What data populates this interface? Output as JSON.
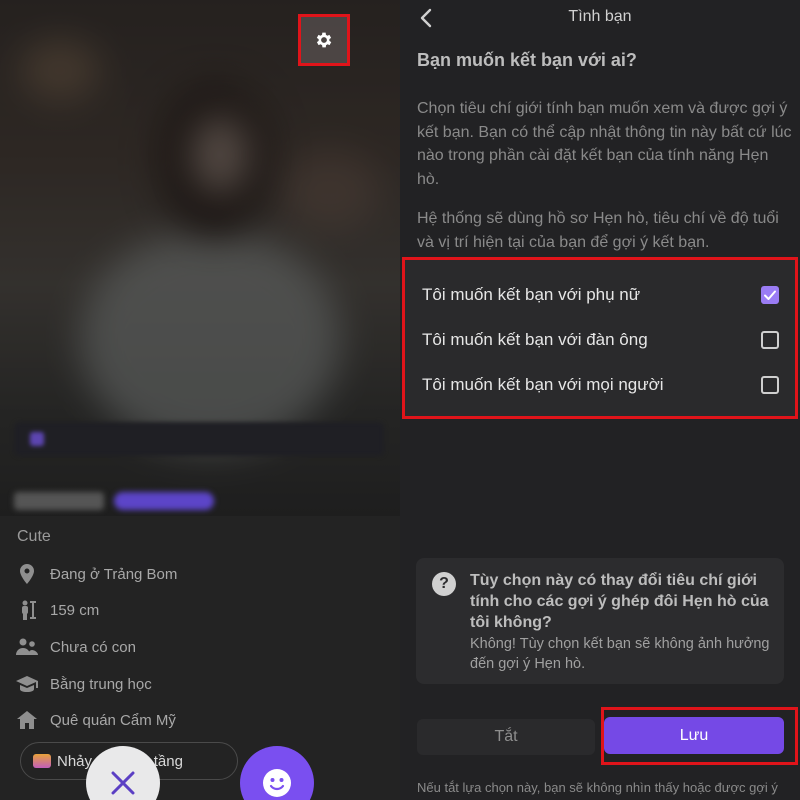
{
  "profile": {
    "bio": "Cute",
    "details": [
      {
        "icon": "location-pin-icon",
        "text": "Đang ở Trảng Bom"
      },
      {
        "icon": "height-icon",
        "text": "159 cm"
      },
      {
        "icon": "children-icon",
        "text": "Chưa có con"
      },
      {
        "icon": "education-cap-icon",
        "text": "Bằng trung học"
      },
      {
        "icon": "home-icon",
        "text": "Quê quán Cẩm Mỹ"
      }
    ],
    "interest_chip": "Nhảy ... à cao tầng"
  },
  "friendship": {
    "title": "Tình bạn",
    "question": "Bạn muốn kết bạn với ai?",
    "paragraph1": "Chọn tiêu chí giới tính bạn muốn xem và được gợi ý kết bạn. Bạn có thể cập nhật thông tin này bất cứ lúc nào trong phần cài đặt kết bạn của tính năng Hẹn hò.",
    "paragraph2": "Hệ thống sẽ dùng hồ sơ Hẹn hò, tiêu chí về độ tuổi và vị trí hiện tại của bạn để gợi ý kết bạn.",
    "options": [
      {
        "label": "Tôi muốn kết bạn với phụ nữ",
        "checked": true
      },
      {
        "label": "Tôi muốn kết bạn với đàn ông",
        "checked": false
      },
      {
        "label": "Tôi muốn kết bạn với mọi người",
        "checked": false
      }
    ],
    "faq": {
      "question": "Tùy chọn này có thay đổi tiêu chí giới tính cho các gợi ý ghép đôi Hẹn hò của tôi không?",
      "answer": "Không! Tùy chọn kết bạn sẽ không ảnh hưởng đến gợi ý Hẹn hò."
    },
    "off_label": "Tắt",
    "save_label": "Lưu",
    "footnote": "Nếu tắt lựa chọn này, bạn sẽ không nhìn thấy hoặc được gợi ý"
  },
  "colors": {
    "accent": "#7549e6",
    "highlight": "#e0141a"
  }
}
